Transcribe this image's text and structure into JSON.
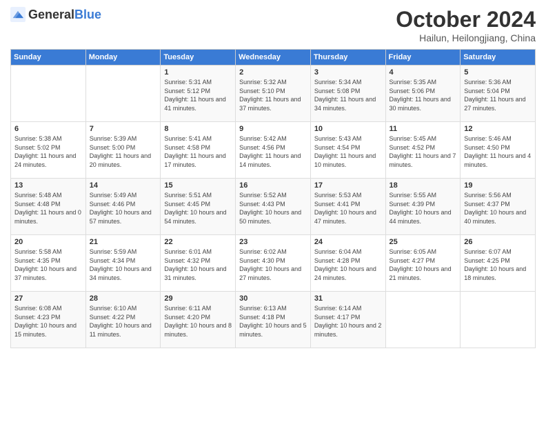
{
  "header": {
    "logo_general": "General",
    "logo_blue": "Blue",
    "title": "October 2024",
    "location": "Hailun, Heilongjiang, China"
  },
  "weekdays": [
    "Sunday",
    "Monday",
    "Tuesday",
    "Wednesday",
    "Thursday",
    "Friday",
    "Saturday"
  ],
  "weeks": [
    [
      {
        "day": "",
        "info": ""
      },
      {
        "day": "",
        "info": ""
      },
      {
        "day": "1",
        "info": "Sunrise: 5:31 AM\nSunset: 5:12 PM\nDaylight: 11 hours and 41 minutes."
      },
      {
        "day": "2",
        "info": "Sunrise: 5:32 AM\nSunset: 5:10 PM\nDaylight: 11 hours and 37 minutes."
      },
      {
        "day": "3",
        "info": "Sunrise: 5:34 AM\nSunset: 5:08 PM\nDaylight: 11 hours and 34 minutes."
      },
      {
        "day": "4",
        "info": "Sunrise: 5:35 AM\nSunset: 5:06 PM\nDaylight: 11 hours and 30 minutes."
      },
      {
        "day": "5",
        "info": "Sunrise: 5:36 AM\nSunset: 5:04 PM\nDaylight: 11 hours and 27 minutes."
      }
    ],
    [
      {
        "day": "6",
        "info": "Sunrise: 5:38 AM\nSunset: 5:02 PM\nDaylight: 11 hours and 24 minutes."
      },
      {
        "day": "7",
        "info": "Sunrise: 5:39 AM\nSunset: 5:00 PM\nDaylight: 11 hours and 20 minutes."
      },
      {
        "day": "8",
        "info": "Sunrise: 5:41 AM\nSunset: 4:58 PM\nDaylight: 11 hours and 17 minutes."
      },
      {
        "day": "9",
        "info": "Sunrise: 5:42 AM\nSunset: 4:56 PM\nDaylight: 11 hours and 14 minutes."
      },
      {
        "day": "10",
        "info": "Sunrise: 5:43 AM\nSunset: 4:54 PM\nDaylight: 11 hours and 10 minutes."
      },
      {
        "day": "11",
        "info": "Sunrise: 5:45 AM\nSunset: 4:52 PM\nDaylight: 11 hours and 7 minutes."
      },
      {
        "day": "12",
        "info": "Sunrise: 5:46 AM\nSunset: 4:50 PM\nDaylight: 11 hours and 4 minutes."
      }
    ],
    [
      {
        "day": "13",
        "info": "Sunrise: 5:48 AM\nSunset: 4:48 PM\nDaylight: 11 hours and 0 minutes."
      },
      {
        "day": "14",
        "info": "Sunrise: 5:49 AM\nSunset: 4:46 PM\nDaylight: 10 hours and 57 minutes."
      },
      {
        "day": "15",
        "info": "Sunrise: 5:51 AM\nSunset: 4:45 PM\nDaylight: 10 hours and 54 minutes."
      },
      {
        "day": "16",
        "info": "Sunrise: 5:52 AM\nSunset: 4:43 PM\nDaylight: 10 hours and 50 minutes."
      },
      {
        "day": "17",
        "info": "Sunrise: 5:53 AM\nSunset: 4:41 PM\nDaylight: 10 hours and 47 minutes."
      },
      {
        "day": "18",
        "info": "Sunrise: 5:55 AM\nSunset: 4:39 PM\nDaylight: 10 hours and 44 minutes."
      },
      {
        "day": "19",
        "info": "Sunrise: 5:56 AM\nSunset: 4:37 PM\nDaylight: 10 hours and 40 minutes."
      }
    ],
    [
      {
        "day": "20",
        "info": "Sunrise: 5:58 AM\nSunset: 4:35 PM\nDaylight: 10 hours and 37 minutes."
      },
      {
        "day": "21",
        "info": "Sunrise: 5:59 AM\nSunset: 4:34 PM\nDaylight: 10 hours and 34 minutes."
      },
      {
        "day": "22",
        "info": "Sunrise: 6:01 AM\nSunset: 4:32 PM\nDaylight: 10 hours and 31 minutes."
      },
      {
        "day": "23",
        "info": "Sunrise: 6:02 AM\nSunset: 4:30 PM\nDaylight: 10 hours and 27 minutes."
      },
      {
        "day": "24",
        "info": "Sunrise: 6:04 AM\nSunset: 4:28 PM\nDaylight: 10 hours and 24 minutes."
      },
      {
        "day": "25",
        "info": "Sunrise: 6:05 AM\nSunset: 4:27 PM\nDaylight: 10 hours and 21 minutes."
      },
      {
        "day": "26",
        "info": "Sunrise: 6:07 AM\nSunset: 4:25 PM\nDaylight: 10 hours and 18 minutes."
      }
    ],
    [
      {
        "day": "27",
        "info": "Sunrise: 6:08 AM\nSunset: 4:23 PM\nDaylight: 10 hours and 15 minutes."
      },
      {
        "day": "28",
        "info": "Sunrise: 6:10 AM\nSunset: 4:22 PM\nDaylight: 10 hours and 11 minutes."
      },
      {
        "day": "29",
        "info": "Sunrise: 6:11 AM\nSunset: 4:20 PM\nDaylight: 10 hours and 8 minutes."
      },
      {
        "day": "30",
        "info": "Sunrise: 6:13 AM\nSunset: 4:18 PM\nDaylight: 10 hours and 5 minutes."
      },
      {
        "day": "31",
        "info": "Sunrise: 6:14 AM\nSunset: 4:17 PM\nDaylight: 10 hours and 2 minutes."
      },
      {
        "day": "",
        "info": ""
      },
      {
        "day": "",
        "info": ""
      }
    ]
  ]
}
